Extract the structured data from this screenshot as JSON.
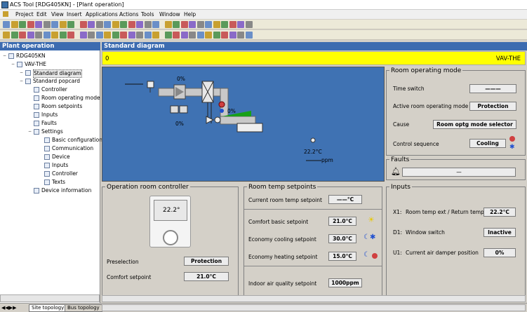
{
  "window": {
    "title": "ACS Tool [RDG405KN] - [Plant operation]"
  },
  "menu": [
    "Project",
    "Edit",
    "View",
    "Insert",
    "Applications",
    "Actions",
    "Tools",
    "Window",
    "Help"
  ],
  "left_panel": {
    "title": "Plant operation",
    "tree": [
      {
        "label": "RDG405KN",
        "level": 0
      },
      {
        "label": "VAV-THE",
        "level": 1
      },
      {
        "label": "Standard diagram",
        "level": 2,
        "selected": true
      },
      {
        "label": "Standard popcard",
        "level": 2
      },
      {
        "label": "Controller",
        "level": 3
      },
      {
        "label": "Room operating mode",
        "level": 3
      },
      {
        "label": "Room setpoints",
        "level": 3
      },
      {
        "label": "Inputs",
        "level": 3
      },
      {
        "label": "Faults",
        "level": 3
      },
      {
        "label": "Settings",
        "level": 3
      },
      {
        "label": "Basic configuration",
        "level": 4
      },
      {
        "label": "Communication",
        "level": 4
      },
      {
        "label": "Device",
        "level": 4
      },
      {
        "label": "Inputs",
        "level": 4
      },
      {
        "label": "Controller",
        "level": 4
      },
      {
        "label": "Texts",
        "level": 4
      },
      {
        "label": "Device information",
        "level": 3
      }
    ]
  },
  "main": {
    "title": "Standard diagram",
    "bar_left": "0",
    "bar_right": "VAV-THE",
    "diagram": {
      "damper_pct": "0%",
      "fan_pct": "0%",
      "valve_pct": "0%",
      "room_temp": "22.2°C",
      "co2": "ppm"
    },
    "room_mode": {
      "title": "Room operating mode",
      "time_switch_label": "Time switch",
      "time_switch_value": "———",
      "active_label": "Active room operating mode",
      "active_value": "Protection",
      "cause_label": "Cause",
      "cause_value": "Room optg mode selector",
      "control_label": "Control sequence",
      "control_value": "Cooling"
    },
    "faults": {
      "title": "Faults",
      "value": "—"
    },
    "op_controller": {
      "title": "Operation room controller",
      "display": "22.2°",
      "preselection_label": "Preselection",
      "preselection_value": "Protection",
      "comfort_label": "Comfort setpoint",
      "comfort_value": "21.0°C"
    },
    "setpoints": {
      "title": "Room temp setpoints",
      "current_label": "Current room temp setpoint",
      "current_value": "——°C",
      "comfort_label": "Comfort basic setpoint",
      "comfort_value": "21.0°C",
      "eco_cool_label": "Economy cooling setpoint",
      "eco_cool_value": "30.0°C",
      "eco_heat_label": "Economy heating setpoint",
      "eco_heat_value": "15.0°C",
      "iaq_label": "Indoor air quality setpoint",
      "iaq_value": "1000ppm"
    },
    "inputs": {
      "title": "Inputs",
      "x1_id": "X1:",
      "x1_label": "Room temp ext / Return temp",
      "x1_value": "22.2°C",
      "d1_id": "D1:",
      "d1_label": "Window switch",
      "d1_value": "Inactive",
      "u1_id": "U1:",
      "u1_label": "Current air damper position",
      "u1_value": "0%"
    }
  },
  "status_tabs": [
    "Site topology",
    "Bus topology"
  ],
  "colors": {
    "header": "#3c6bb0",
    "diagram_bg": "#3f72b3",
    "bar": "#ffff00"
  }
}
